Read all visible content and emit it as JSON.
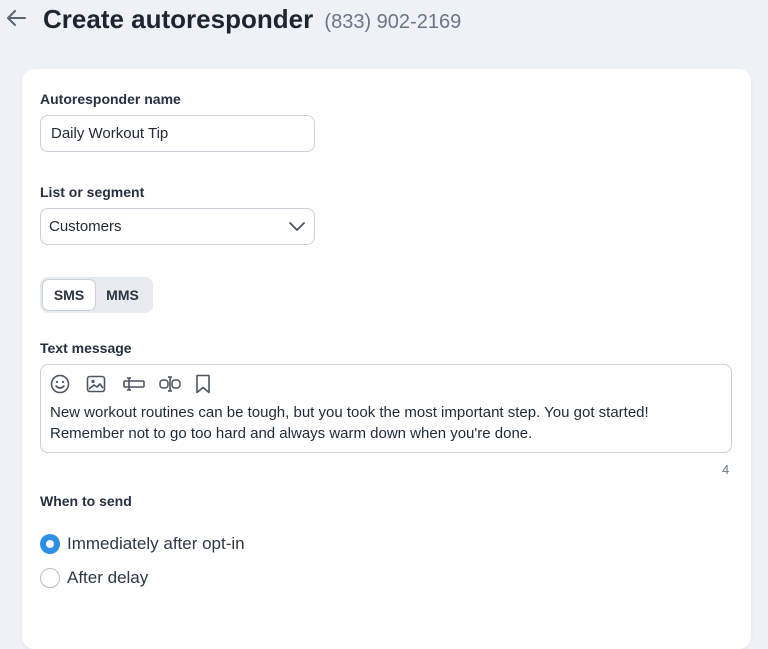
{
  "header": {
    "title": "Create autoresponder",
    "phone": "(833) 902-2169"
  },
  "form": {
    "name_label": "Autoresponder name",
    "name_value": "Daily Workout Tip",
    "list_label": "List or segment",
    "list_value": "Customers",
    "toggle": {
      "sms": "SMS",
      "mms": "MMS",
      "selected": "SMS"
    },
    "message_label": "Text message",
    "message_text": "New workout routines can be tough, but you took the most important step. You got started! Remember not to go too hard and always warm down when you're done.",
    "char_counter": "4",
    "when_label": "When to send",
    "options": [
      {
        "label": "Immediately after opt-in",
        "selected": true
      },
      {
        "label": "After delay",
        "selected": false
      }
    ]
  },
  "toolbar_icons": [
    "emoji-icon",
    "image-icon",
    "text-field-icon",
    "link-field-icon",
    "bookmark-icon"
  ],
  "colors": {
    "accent": "#2f8fe3",
    "background": "#eef1f5"
  }
}
